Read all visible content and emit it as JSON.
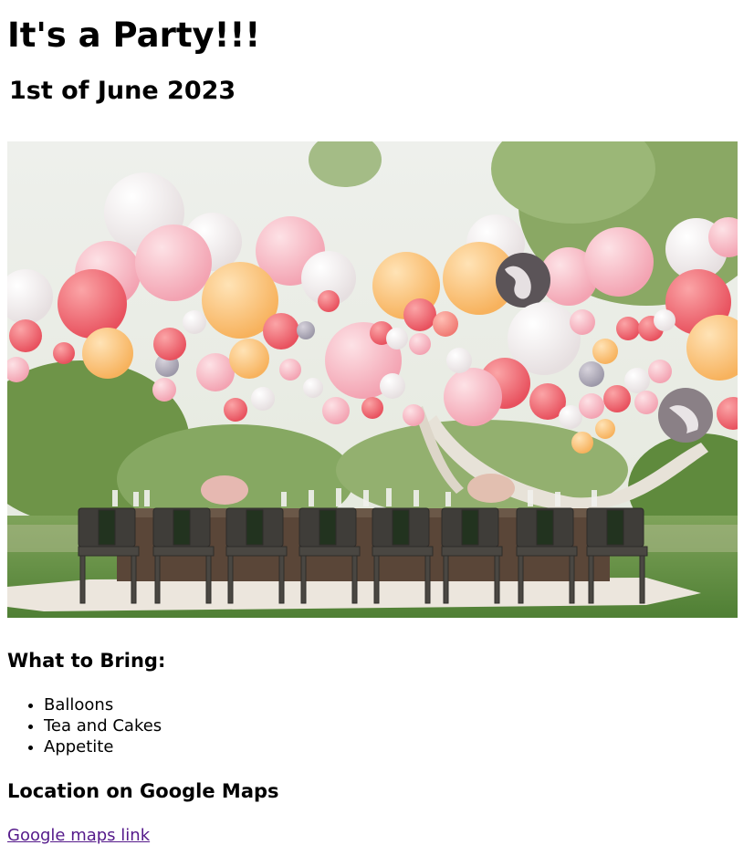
{
  "page": {
    "title": "It's a Party!!!",
    "date": "1st of June 2023"
  },
  "hero_image": {
    "icon": "party-photo-balloons-table"
  },
  "bring": {
    "heading": "What to Bring:",
    "items": [
      "Balloons",
      "Tea and Cakes",
      "Appetite"
    ]
  },
  "location": {
    "heading": "Location on Google Maps",
    "link_label": "Google maps link"
  },
  "colors": {
    "link_visited": "#551a8b"
  }
}
